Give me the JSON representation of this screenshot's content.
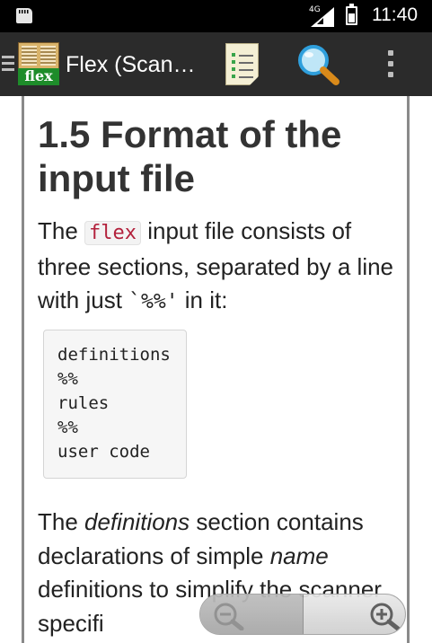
{
  "status_bar": {
    "network_label": "4G",
    "time": "11:40",
    "icons": [
      "sd-card-icon",
      "signal-icon",
      "battery-icon"
    ]
  },
  "app_bar": {
    "logo_text": "flex",
    "title": "Flex (Scan…",
    "icons": [
      "menu-icon",
      "table-of-contents-icon",
      "search-icon",
      "overflow-menu-icon"
    ]
  },
  "content": {
    "heading": "1.5 Format of the input file",
    "intro": {
      "before_code": "The ",
      "code": "flex",
      "after_code": " input file consists of three sections, separated by a line with just ",
      "marker": "`%%'",
      "after_marker": " in it:"
    },
    "code_block": [
      "definitions",
      "%%",
      "rules",
      "%%",
      "user code"
    ],
    "para2": {
      "t1": "The ",
      "em1": "definitions",
      "t2": " section contains declarations of simple ",
      "em2": "name",
      "t3": " definitions to simplify the scanner specifi"
    }
  },
  "zoom": {
    "zoom_out_icon": "zoom-out-icon",
    "zoom_in_icon": "zoom-in-icon"
  },
  "colors": {
    "status_bar": "#000000",
    "app_bar": "#2b2b2b",
    "inline_code_text": "#b3213c",
    "logo_green": "#1e8c2a"
  }
}
